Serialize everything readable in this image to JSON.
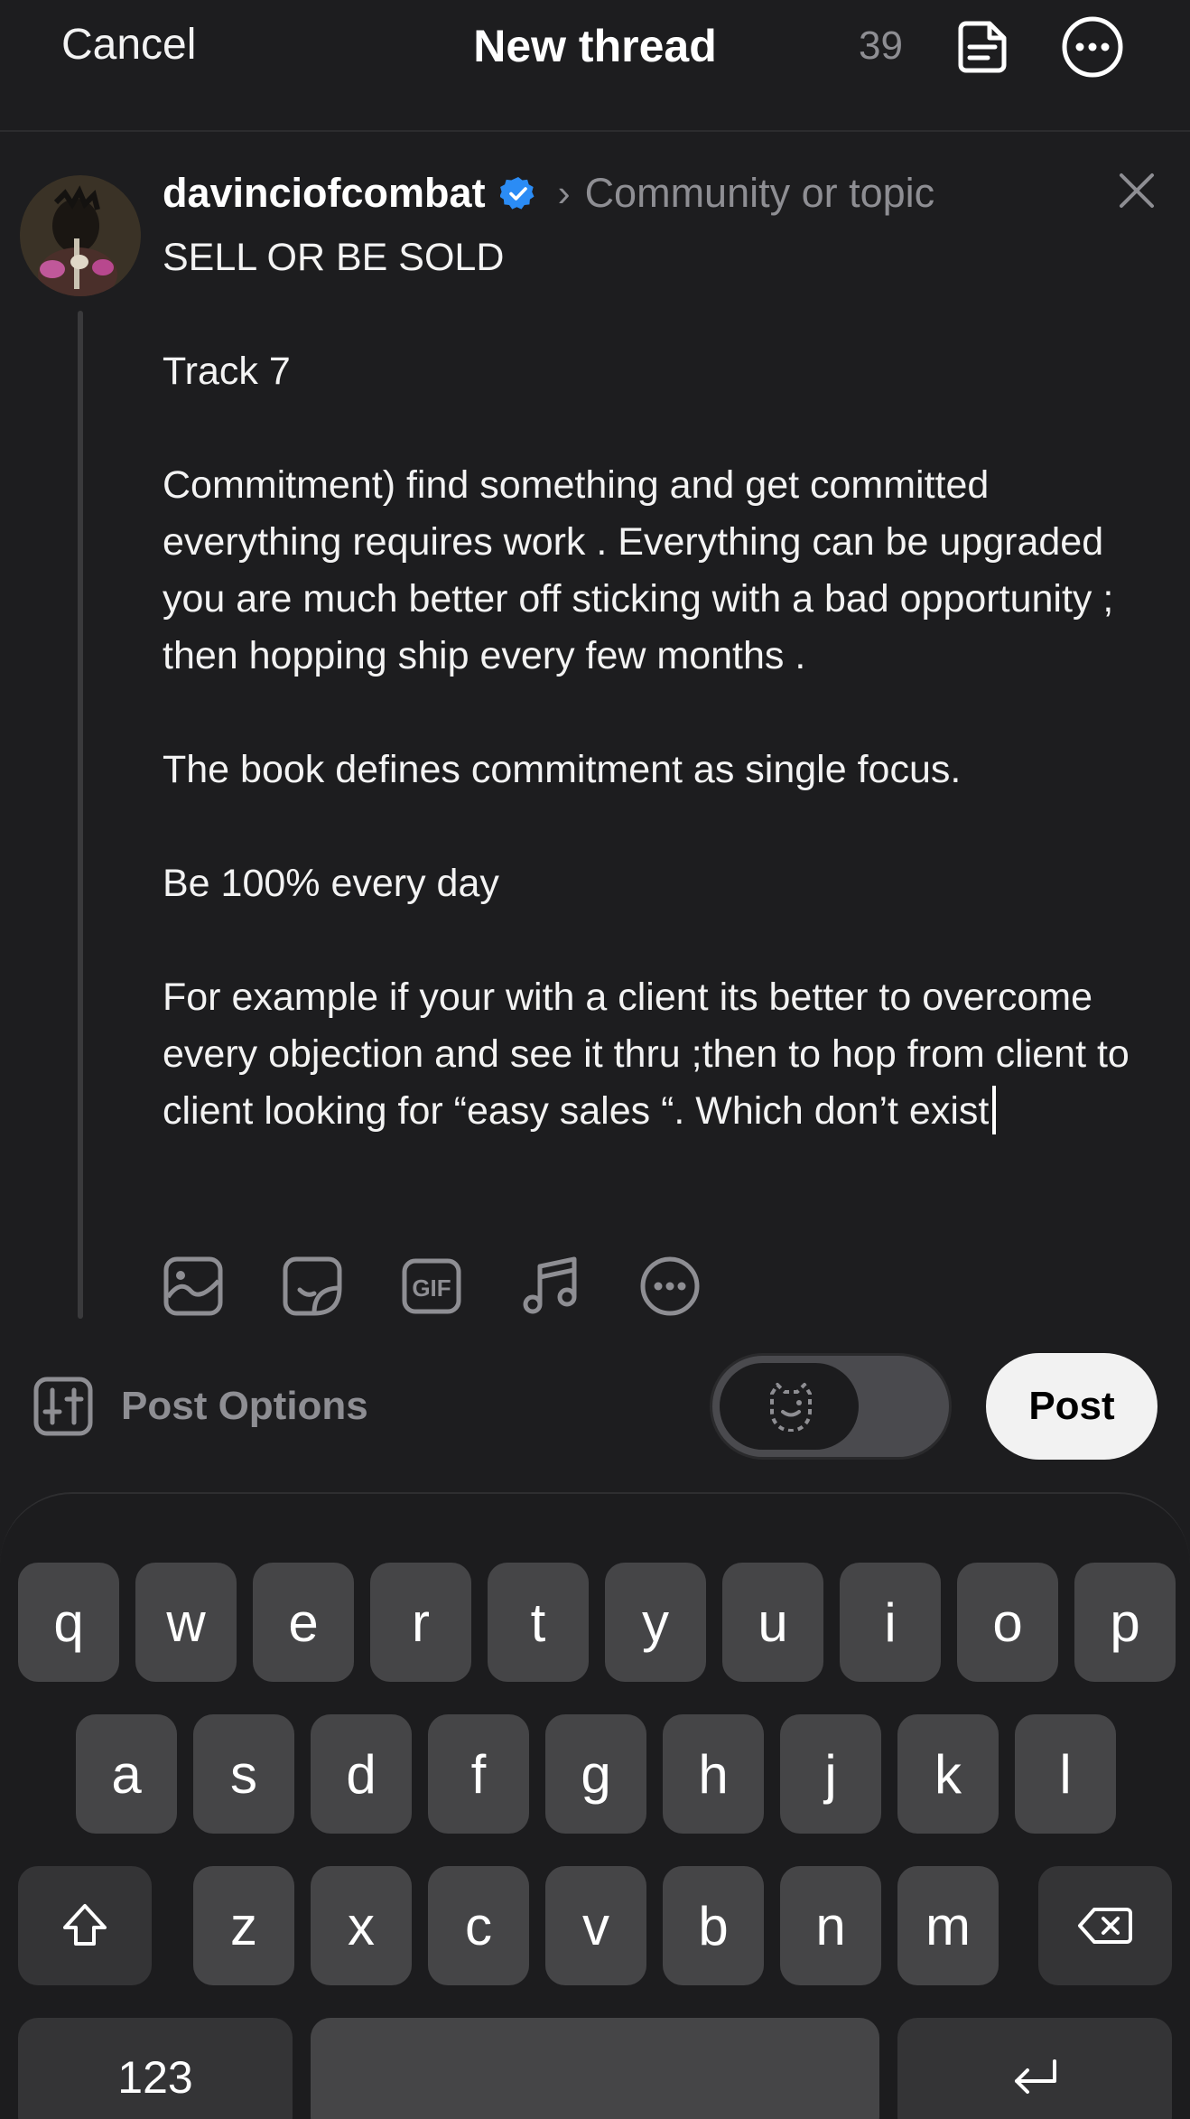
{
  "header": {
    "cancel_label": "Cancel",
    "title": "New thread",
    "char_count": "39",
    "draft_icon": "drafts-icon",
    "more_icon": "more-options-icon"
  },
  "composer": {
    "username": "davinciofcombat",
    "verified": true,
    "community_placeholder": "Community or topic",
    "text": "SELL OR BE SOLD\n\nTrack 7\n\nCommitment) find something and get committed everything requires work . Everything can be upgraded you are much better off sticking with a bad opportunity ; then hopping ship every few months .\n\nThe book defines commitment as single focus.\n\nBe 100% every day\n\nFor example if your with a client its better to overcome every objection and see it thru ;then to hop from client to client looking for “easy sales “. Which don’t exist",
    "tools": [
      "image-icon",
      "sticker-icon",
      "gif-icon",
      "music-icon",
      "more-icon"
    ]
  },
  "footer": {
    "post_options_label": "Post Options",
    "post_label": "Post",
    "accent_color": "#2b8cf5"
  },
  "keyboard": {
    "row1": [
      "q",
      "w",
      "e",
      "r",
      "t",
      "y",
      "u",
      "i",
      "o",
      "p"
    ],
    "row2": [
      "a",
      "s",
      "d",
      "f",
      "g",
      "h",
      "j",
      "k",
      "l"
    ],
    "row3": [
      "z",
      "x",
      "c",
      "v",
      "b",
      "n",
      "m"
    ],
    "numbers_label": "123"
  }
}
